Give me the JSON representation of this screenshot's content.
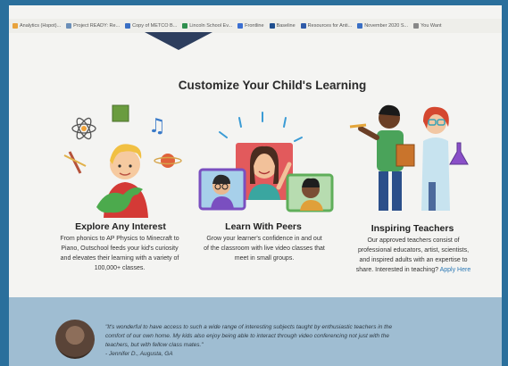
{
  "bookmarks": [
    {
      "label": "Analytics (Hspot)...",
      "color": "#e8a33d"
    },
    {
      "label": "Project READY: Re...",
      "color": "#6b8fb8"
    },
    {
      "label": "Copy of METCO B...",
      "color": "#3a6fc4"
    },
    {
      "label": "Lincoln School Ev...",
      "color": "#2f8f4e"
    },
    {
      "label": "Frontline",
      "color": "#3b6fd1"
    },
    {
      "label": "Baseline",
      "color": "#1f4f8f"
    },
    {
      "label": "Resources for Anti...",
      "color": "#2e5aa8"
    },
    {
      "label": "November 2020 S...",
      "color": "#3a6fc4"
    },
    {
      "label": "You Want",
      "color": "#888888"
    }
  ],
  "page": {
    "heading": "Customize Your Child's Learning"
  },
  "columns": [
    {
      "title": "Explore Any Interest",
      "lines": [
        "From phonics to AP Physics to Minecraft to",
        "Piano, Outschool feeds your kid's curiosity",
        "and elevates their learning with a variety of",
        "100,000+ classes."
      ]
    },
    {
      "title": "Learn With Peers",
      "lines": [
        "Grow your learner's confidence in and out",
        "of the classroom with live video classes that",
        "meet in small groups."
      ]
    },
    {
      "title": "Inspiring Teachers",
      "lines": [
        "Our approved teachers consist of",
        "professional educators, artist, scientists,",
        "and inspired adults with an expertise to"
      ],
      "last_line_text": "share. Interested in teaching?",
      "link": "Apply Here"
    }
  ],
  "testimonial": {
    "lines": [
      "\"It's wonderful to have access to such a wide range of interesting subjects taught by enthusiastic teachers in the",
      "comfort of our own home. My kids also enjoy being able to interact through video conferencing not just with the",
      "teachers, but with fellow class mates.\""
    ],
    "author": "- Jennifer D., Augusta, GA"
  }
}
